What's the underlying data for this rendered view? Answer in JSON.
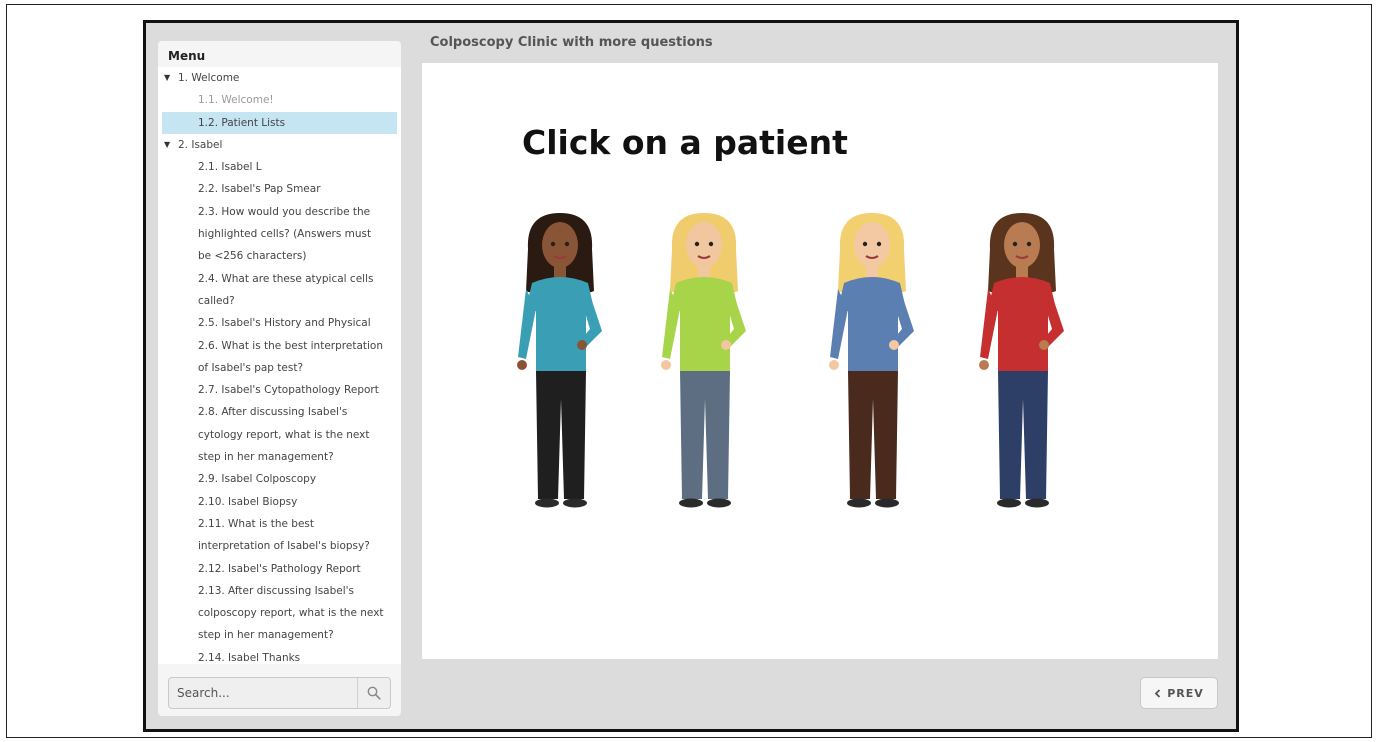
{
  "header": {
    "course_title": "Colposcopy Clinic with more questions"
  },
  "sidebar": {
    "tab_label": "Menu",
    "items": [
      {
        "label": "1. Welcome",
        "kind": "section"
      },
      {
        "label": "1.1. Welcome!",
        "kind": "item",
        "state": "dim"
      },
      {
        "label": "1.2. Patient Lists",
        "kind": "item",
        "state": "selected"
      },
      {
        "label": "2. Isabel",
        "kind": "section"
      },
      {
        "label": "2.1. Isabel L",
        "kind": "item"
      },
      {
        "label": "2.2. Isabel's Pap Smear",
        "kind": "item"
      },
      {
        "label": "2.3. How would you describe the",
        "kind": "item"
      },
      {
        "label": "highlighted cells? (Answers must",
        "kind": "item"
      },
      {
        "label": "be <256 characters)",
        "kind": "item"
      },
      {
        "label": "2.4. What are these atypical cells",
        "kind": "item"
      },
      {
        "label": "called?",
        "kind": "item"
      },
      {
        "label": "2.5. Isabel's History and Physical",
        "kind": "item"
      },
      {
        "label": "2.6. What is the best interpretation",
        "kind": "item"
      },
      {
        "label": "of Isabel's pap test?",
        "kind": "item"
      },
      {
        "label": "2.7. Isabel's Cytopathology Report",
        "kind": "item"
      },
      {
        "label": "2.8. After discussing Isabel's",
        "kind": "item"
      },
      {
        "label": "cytology report, what is the next",
        "kind": "item"
      },
      {
        "label": "step in her management?",
        "kind": "item"
      },
      {
        "label": "2.9. Isabel Colposcopy",
        "kind": "item"
      },
      {
        "label": "2.10. Isabel Biopsy",
        "kind": "item"
      },
      {
        "label": "2.11. What is the best",
        "kind": "item"
      },
      {
        "label": "interpretation of Isabel's biopsy?",
        "kind": "item"
      },
      {
        "label": "2.12. Isabel's Pathology Report",
        "kind": "item"
      },
      {
        "label": "2.13. After discussing Isabel's",
        "kind": "item"
      },
      {
        "label": "colposcopy report, what is the next",
        "kind": "item"
      },
      {
        "label": "step in her management?",
        "kind": "item"
      },
      {
        "label": "2.14. Isabel Thanks",
        "kind": "item"
      }
    ]
  },
  "search": {
    "placeholder": "Search...",
    "icon": "search-icon"
  },
  "slide": {
    "heading": "Click on a patient",
    "patients": [
      {
        "hair": "#2a1a12",
        "skin": "#8a5536",
        "top": "#3a9fb5",
        "pants": "#1f1f1f"
      },
      {
        "hair": "#f0cc6c",
        "skin": "#f1c79f",
        "top": "#a8d44a",
        "pants": "#5d6e82"
      },
      {
        "hair": "#f2d070",
        "skin": "#f2c9a2",
        "top": "#5a7fb0",
        "pants": "#4a2a1c"
      },
      {
        "hair": "#5a341d",
        "skin": "#b87b52",
        "top": "#c62f2f",
        "pants": "#2d3f66"
      }
    ]
  },
  "nav": {
    "prev_label": "PREV",
    "prev_icon": "chevron-left-icon"
  },
  "colors": {
    "selected_bg": "#c5e5f3",
    "frame_bg": "#dcdcdc"
  }
}
